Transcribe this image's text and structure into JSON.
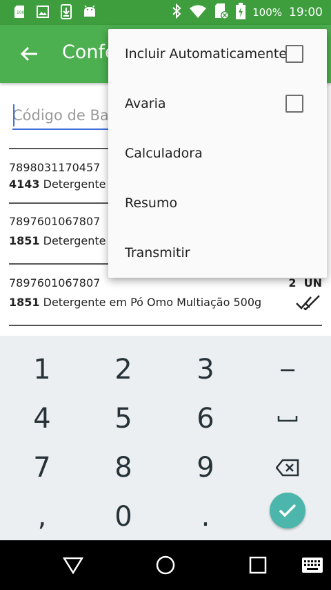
{
  "status_bar": {
    "battery": "100%",
    "time": "19:00",
    "icons": [
      "sim-icon",
      "image-icon",
      "download-icon",
      "android-icon",
      "bluetooth-icon",
      "wifi-icon",
      "no-sim-icon",
      "battery-charging-icon"
    ]
  },
  "app_bar": {
    "title": "Confe",
    "back_icon": "arrow-back-icon"
  },
  "barcode_input": {
    "placeholder": "Código de Barras",
    "value": ""
  },
  "items": [
    {
      "barcode": "7898031170457",
      "product_code": "4143",
      "description": "Detergente e",
      "quantity": "",
      "unit": ""
    },
    {
      "barcode": "7897601067807",
      "product_code": "1851",
      "description": "Detergente e",
      "quantity": "",
      "unit": ""
    },
    {
      "barcode": "7897601067807",
      "product_code": "1851",
      "description": "Detergente em Pó Omo Multiação 500g",
      "quantity": "2",
      "unit": "UN",
      "status_icon": "double-check-icon"
    }
  ],
  "keyboard": {
    "rows": [
      [
        "1",
        "2",
        "3",
        "−"
      ],
      [
        "4",
        "5",
        "6",
        "␣"
      ],
      [
        "7",
        "8",
        "9",
        "⌫"
      ],
      [
        ",",
        "0",
        ".",
        "✓"
      ]
    ],
    "accent": "#4db6ac"
  },
  "overflow_menu": {
    "items": [
      {
        "label": "Incluir Automaticamente",
        "checkbox": true,
        "checked": false
      },
      {
        "label": "Avaria",
        "checkbox": true,
        "checked": false
      },
      {
        "label": "Calculadora",
        "checkbox": false
      },
      {
        "label": "Resumo",
        "checkbox": false
      },
      {
        "label": "Transmitir",
        "checkbox": false
      }
    ]
  },
  "nav_bar": {
    "icons": [
      "back-triangle-icon",
      "home-circle-icon",
      "recents-square-icon",
      "keyboard-icon"
    ]
  },
  "colors": {
    "status_bar": "#3e9e3e",
    "app_bar": "#4caf50",
    "input_underline": "#3f6fd8"
  }
}
